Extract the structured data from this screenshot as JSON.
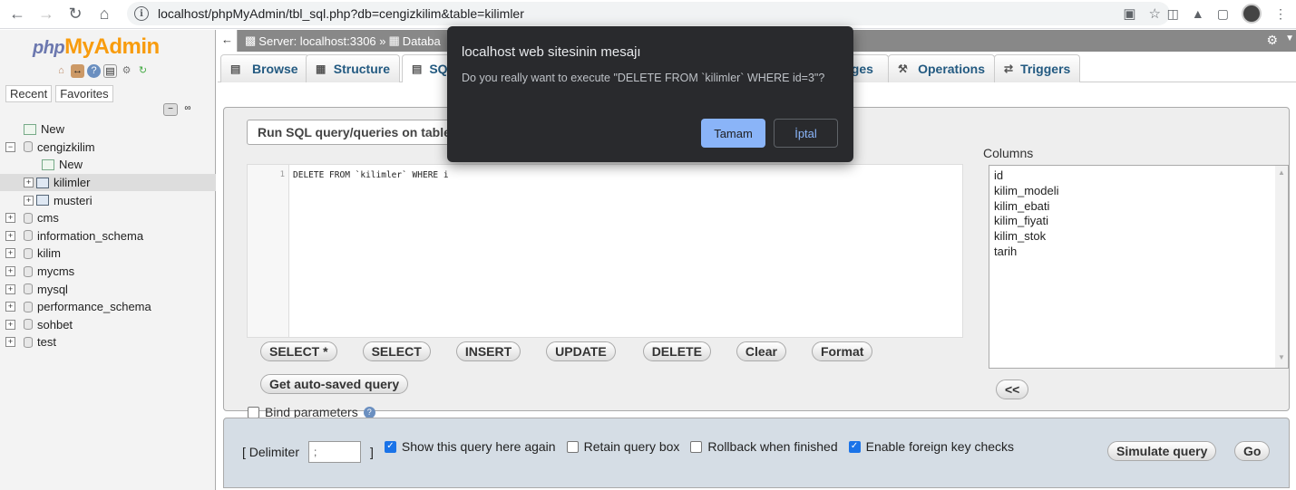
{
  "browser": {
    "url": "localhost/phpMyAdmin/tbl_sql.php?db=cengizkilim&table=kilimler"
  },
  "logo": {
    "php": "php",
    "my": "My",
    "admin": "Admin"
  },
  "sidebar": {
    "recent_label": "Recent",
    "favorites_label": "Favorites",
    "tree": [
      {
        "label": "New",
        "level": 0,
        "type": "new"
      },
      {
        "label": "cengizkilim",
        "level": 0,
        "type": "db",
        "expanded": true
      },
      {
        "label": "New",
        "level": 1,
        "type": "new"
      },
      {
        "label": "kilimler",
        "level": 1,
        "type": "table",
        "selected": true
      },
      {
        "label": "musteri",
        "level": 1,
        "type": "table"
      },
      {
        "label": "cms",
        "level": 0,
        "type": "db"
      },
      {
        "label": "information_schema",
        "level": 0,
        "type": "db"
      },
      {
        "label": "kilim",
        "level": 0,
        "type": "db"
      },
      {
        "label": "mycms",
        "level": 0,
        "type": "db"
      },
      {
        "label": "mysql",
        "level": 0,
        "type": "db"
      },
      {
        "label": "performance_schema",
        "level": 0,
        "type": "db"
      },
      {
        "label": "sohbet",
        "level": 0,
        "type": "db"
      },
      {
        "label": "test",
        "level": 0,
        "type": "db"
      }
    ]
  },
  "breadcrumb": {
    "server": "Server: localhost:3306 »",
    "database": "Databa"
  },
  "menu_tabs": {
    "browse": "Browse",
    "structure": "Structure",
    "sql": "SQ",
    "privileges": "eges",
    "operations": "Operations",
    "triggers": "Triggers"
  },
  "sql_panel": {
    "legend": "Run SQL query/queries on table ce",
    "line_number": "1",
    "query": "DELETE FROM `kilimler` WHERE i",
    "buttons": {
      "select_star": "SELECT *",
      "select": "SELECT",
      "insert": "INSERT",
      "update": "UPDATE",
      "delete": "DELETE",
      "clear": "Clear",
      "format": "Format"
    },
    "get_autosaved": "Get auto-saved query",
    "bind_parameters": "Bind parameters",
    "columns_label": "Columns",
    "columns": [
      "id",
      "kilim_modeli",
      "kilim_ebati",
      "kilim_fiyati",
      "kilim_stok",
      "tarih"
    ],
    "insert_col_btn": "<<"
  },
  "options": {
    "delimiter_open": "[ Delimiter",
    "delimiter_value": ";",
    "delimiter_close": "]",
    "show_query": "Show this query here again",
    "retain_box": "Retain query box",
    "rollback": "Rollback when finished",
    "foreign_keys": "Enable foreign key checks",
    "simulate": "Simulate query",
    "go": "Go"
  },
  "dialog": {
    "title": "localhost web sitesinin mesajı",
    "message": "Do you really want to execute \"DELETE FROM `kilimler` WHERE id=3\"?",
    "ok": "Tamam",
    "cancel": "İptal"
  }
}
